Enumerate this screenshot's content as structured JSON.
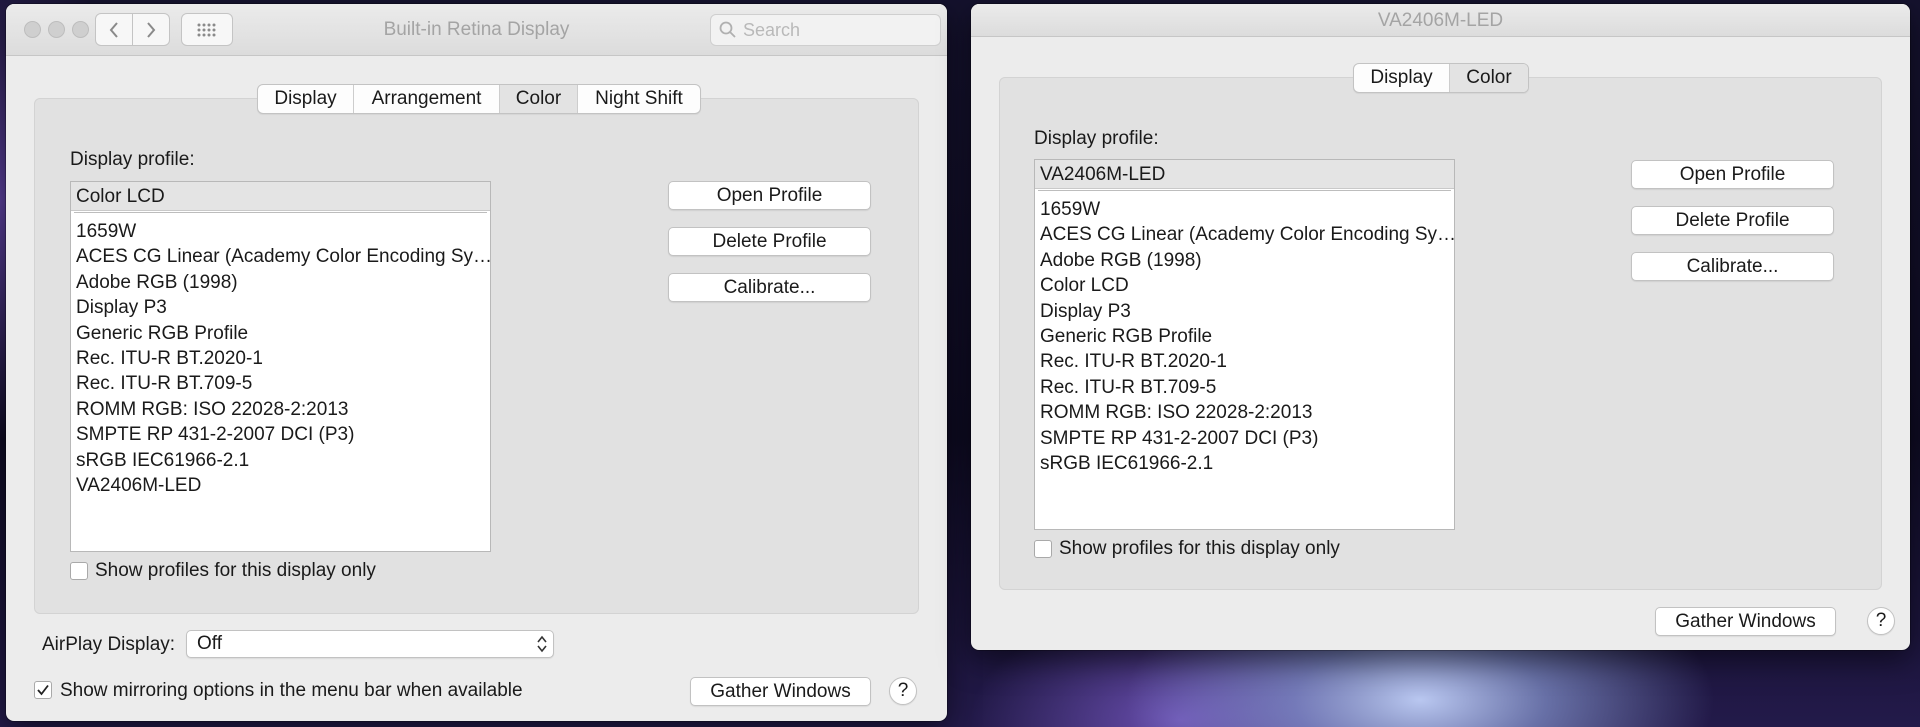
{
  "left_window": {
    "title": "Built-in Retina Display",
    "search_placeholder": "Search",
    "tabs": [
      {
        "label": "Display",
        "selected": false
      },
      {
        "label": "Arrangement",
        "selected": false
      },
      {
        "label": "Color",
        "selected": true
      },
      {
        "label": "Night Shift",
        "selected": false
      }
    ],
    "display_profile_label": "Display profile:",
    "selected_profile": "Color LCD",
    "profiles": [
      "1659W",
      "ACES CG Linear (Academy Color Encoding Sy…",
      "Adobe RGB (1998)",
      "Display P3",
      "Generic RGB Profile",
      "Rec. ITU-R BT.2020-1",
      "Rec. ITU-R BT.709-5",
      "ROMM RGB: ISO 22028-2:2013",
      "SMPTE RP 431-2-2007 DCI (P3)",
      "sRGB IEC61966-2.1",
      "VA2406M-LED"
    ],
    "open_profile": "Open Profile",
    "delete_profile": "Delete Profile",
    "calibrate": "Calibrate...",
    "show_profiles_label": "Show profiles for this display only",
    "show_profiles_checked": false,
    "airplay_label": "AirPlay Display:",
    "airplay_value": "Off",
    "mirroring_label": "Show mirroring options in the menu bar when available",
    "mirroring_checked": true,
    "gather_windows": "Gather Windows",
    "help": "?"
  },
  "right_window": {
    "title": "VA2406M-LED",
    "tabs": [
      {
        "label": "Display",
        "selected": false
      },
      {
        "label": "Color",
        "selected": true
      }
    ],
    "display_profile_label": "Display profile:",
    "selected_profile": "VA2406M-LED",
    "profiles": [
      "1659W",
      "ACES CG Linear (Academy Color Encoding Sy…",
      "Adobe RGB (1998)",
      "Color LCD",
      "Display P3",
      "Generic RGB Profile",
      "Rec. ITU-R BT.2020-1",
      "Rec. ITU-R BT.709-5",
      "ROMM RGB: ISO 22028-2:2013",
      "SMPTE RP 431-2-2007 DCI (P3)",
      "sRGB IEC61966-2.1"
    ],
    "open_profile": "Open Profile",
    "delete_profile": "Delete Profile",
    "calibrate": "Calibrate...",
    "show_profiles_label": "Show profiles for this display only",
    "show_profiles_checked": false,
    "gather_windows": "Gather Windows",
    "help": "?"
  }
}
